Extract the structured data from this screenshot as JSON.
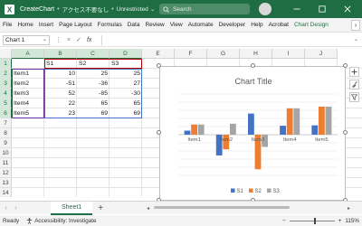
{
  "title_bar": {
    "file_name": "CreateChart",
    "status_sub": "アクセス不要なし",
    "sensitivity": "Unrestricted",
    "search_placeholder": "Search"
  },
  "ribbon": {
    "tabs": [
      "File",
      "Home",
      "Insert",
      "Page Layout",
      "Formulas",
      "Data",
      "Review",
      "View",
      "Automate",
      "Developer",
      "Help",
      "Acrobat",
      "Chart Design"
    ],
    "active_tab": "Chart Design",
    "more": "›"
  },
  "formula_bar": {
    "name_box": "Chart 1",
    "cancel": "×",
    "enter": "✓",
    "fx": "fx",
    "value": ""
  },
  "grid": {
    "columns": [
      "A",
      "B",
      "C",
      "D",
      "E",
      "F",
      "G",
      "H",
      "I",
      "J"
    ],
    "rows": [
      "1",
      "2",
      "3",
      "4",
      "5",
      "6",
      "7",
      "8",
      "9",
      "10",
      "11",
      "12",
      "13",
      "14"
    ],
    "header_row": [
      "",
      "S1",
      "S2",
      "S3"
    ],
    "data": [
      {
        "label": "Item1",
        "s1": "10",
        "s2": "25",
        "s3": "25"
      },
      {
        "label": "Item2",
        "s1": "-51",
        "s2": "-36",
        "s3": "27"
      },
      {
        "label": "Item3",
        "s1": "52",
        "s2": "-85",
        "s3": "-30"
      },
      {
        "label": "Item4",
        "s1": "22",
        "s2": "65",
        "s3": "65"
      },
      {
        "label": "Item5",
        "s1": "23",
        "s2": "69",
        "s3": "69"
      }
    ]
  },
  "chart_data": {
    "type": "bar",
    "title": "Chart Title",
    "categories": [
      "Item1",
      "Item2",
      "Item3",
      "Item4",
      "Item5"
    ],
    "series": [
      {
        "name": "S1",
        "values": [
          10,
          -51,
          52,
          22,
          23
        ],
        "color": "#4472c4"
      },
      {
        "name": "S2",
        "values": [
          25,
          -36,
          -85,
          65,
          69
        ],
        "color": "#ed7d31"
      },
      {
        "name": "S3",
        "values": [
          25,
          27,
          -30,
          65,
          69
        ],
        "color": "#a5a5a5"
      }
    ],
    "ylim": [
      -100,
      100
    ],
    "grid": true,
    "legend": "bottom"
  },
  "sheet_tabs": {
    "sheets": [
      "Sheet1"
    ],
    "add": "+"
  },
  "status_bar": {
    "ready": "Ready",
    "accessibility": "Accessibility: Investigate",
    "zoom": "115%",
    "zoom_out": "−",
    "zoom_in": "+"
  },
  "colors": {
    "brand_green": "#1f6e43",
    "range_s1": "#c00000",
    "range_labels": "#7030a0",
    "range_values": "#4472c4"
  }
}
